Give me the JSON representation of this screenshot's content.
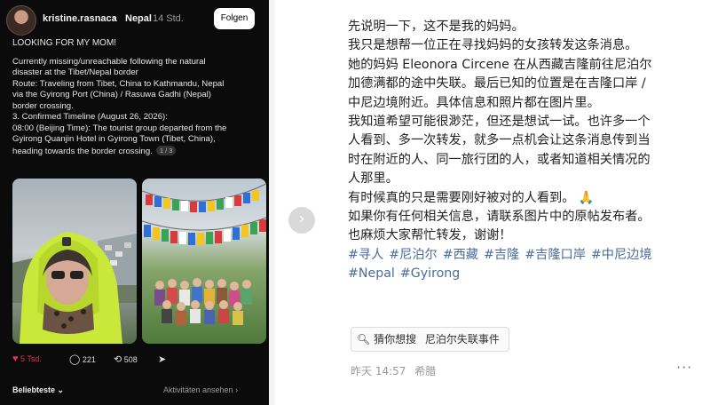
{
  "left_post": {
    "username": "kristine.rasnaca",
    "location": "Nepal",
    "time": "14 Std.",
    "follow_label": "Folgen",
    "headline": "LOOKING FOR MY MOM!",
    "lines": [
      "Currently missing/unreachable following the natural",
      "disaster at the Tibet/Nepal border",
      "Route: Traveling from Tibet, China to Kathmandu, Nepal",
      "via the Gyirong Port (China) / Rasuwa Gadhi (Nepal)",
      "border crossing.",
      "3. Confirmed Timeline (August 26, 2026):",
      "08:00 (Beijing Time): The tourist group departed from the",
      "Gyirong Quanjin Hotel in Gyirong Town (Tibet, China),",
      "heading towards the border crossing."
    ],
    "pager": "1 / 3",
    "likes": "5 Tsd.",
    "comments": "221",
    "reposts": "508",
    "sort_label": "Beliebteste",
    "activity_label": "Aktivitäten ansehen",
    "like_color": "#e0334f"
  },
  "right_post": {
    "lines": [
      "先说明一下，这不是我的妈妈。",
      "我只是想帮一位正在寻找妈妈的女孩转发这条消息。",
      "她的妈妈 Eleonora Circene 在从西藏吉隆前往尼泊尔",
      "加德满都的途中失联。最后已知的位置是在吉隆口岸 /",
      "中尼边境附近。具体信息和照片都在图片里。",
      "我知道希望可能很渺茫，但还是想试一试。也许多一个",
      "人看到、多一次转发，就多一点机会让这条消息传到当",
      "时在附近的人、同一旅行团的人，或者知道相关情况的",
      "人那里。",
      "有时候真的只是需要刚好被对的人看到。",
      "如果你有任何相关信息，请联系图片中的原帖发布者。",
      "也麻烦大家帮忙转发，谢谢！"
    ],
    "pray_emoji": "🙏",
    "tags_line1": [
      "#寻人",
      "#尼泊尔",
      "#西藏",
      "#吉隆",
      "#吉隆口岸",
      "#中尼边境"
    ],
    "tags_line2": [
      "#Nepal",
      "#Gyirong"
    ],
    "search_label": "猜你想搜",
    "search_term": "尼泊尔失联事件",
    "time": "昨天 14:57",
    "location": "希腊",
    "tag_color": "#4a6d9b"
  }
}
